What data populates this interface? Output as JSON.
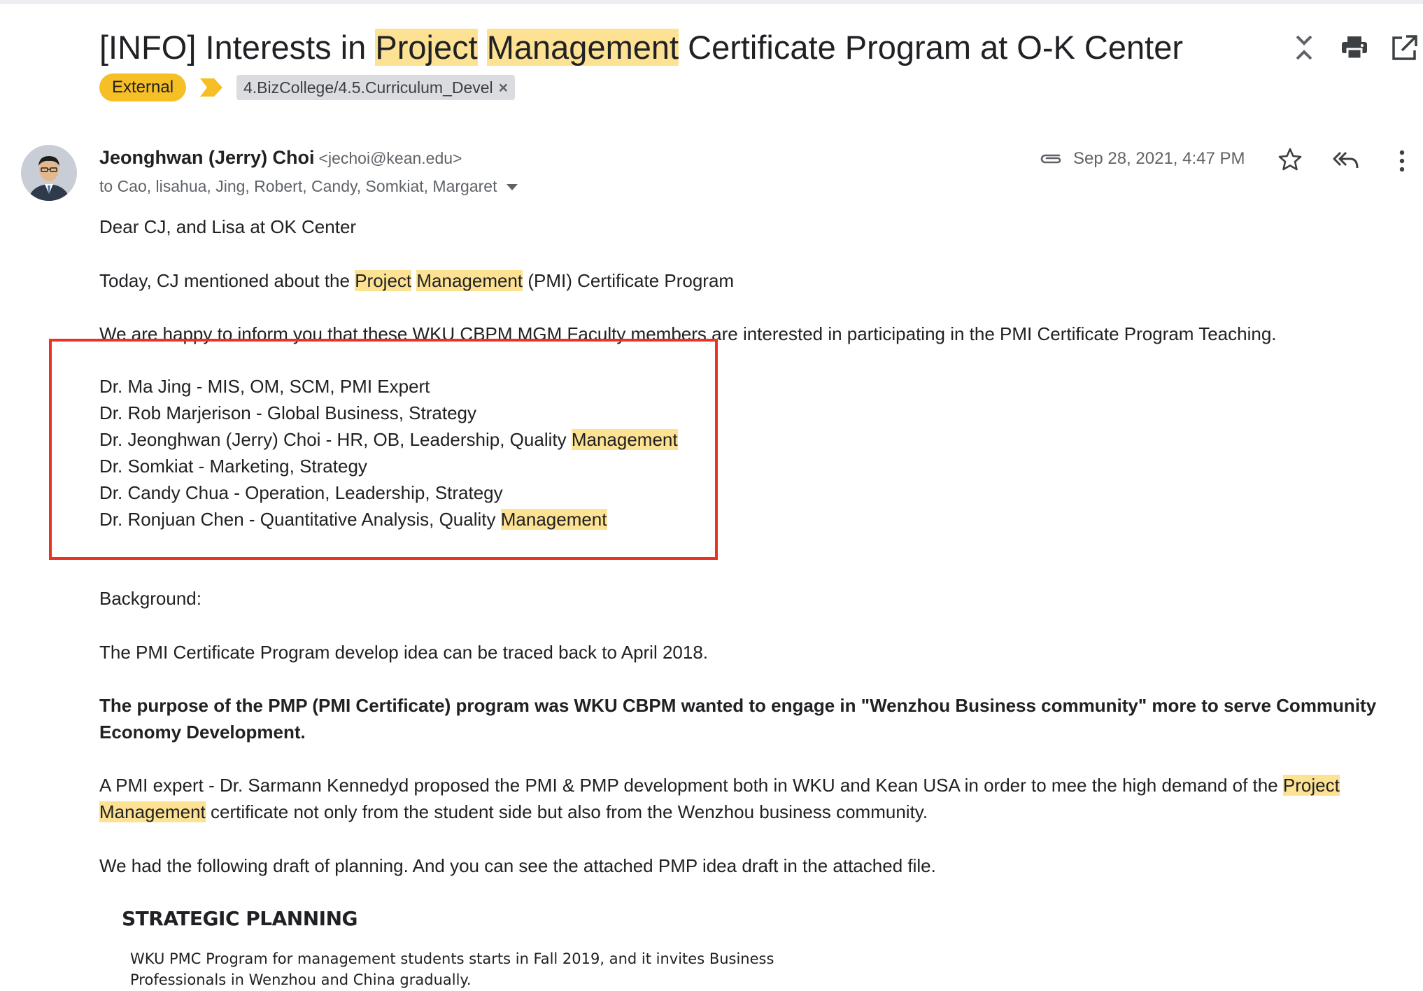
{
  "subject": {
    "prefix": "[INFO] Interests in ",
    "hl1": "Project",
    "space": " ",
    "hl2": "Management",
    "suffix": " Certificate Program at O-K Center"
  },
  "labels": {
    "external": "External",
    "folder": "4.BizCollege/4.5.Curriculum_Devel",
    "remove": "×"
  },
  "toolbar": {
    "collapse_icon": "collapse-expand-icon",
    "print_icon": "print-icon",
    "popout_icon": "open-in-new-window-icon"
  },
  "sender": {
    "name": "Jeonghwan (Jerry) Choi",
    "email": "<jechoi@kean.edu>",
    "recipients": "to Cao, lisahua, Jing, Robert, Candy, Somkiat, Margaret",
    "date": "Sep 28, 2021, 4:47 PM"
  },
  "body": {
    "greeting": "Dear CJ, and Lisa at OK Center",
    "line1_pre": "Today, CJ mentioned about the ",
    "line1_hl1": "Project",
    "line1_hl2": "Management",
    "line1_post": " (PMI) Certificate Program",
    "line2": "We are happy to inform you that these WKU CBPM MGM Faculty members are interested in participating in the PMI Certificate Program Teaching.",
    "faculty": [
      "Dr. Ma Jing - MIS, OM, SCM, PMI Expert",
      "Dr. Rob Marjerison - Global Business, Strategy",
      "Dr. Jeonghwan (Jerry) Choi - HR, OB, Leadership, Quality ",
      "Dr. Somkiat - Marketing, Strategy",
      "Dr. Candy Chua - Operation, Leadership, Strategy",
      "Dr. Ronjuan Chen - Quantitative Analysis, Quality "
    ],
    "faculty_hl": "Management",
    "background": "Background:",
    "traced": "The PMI Certificate Program develop idea can be traced back to April  2018.",
    "purpose": "The purpose of the PMP (PMI Certificate) program was WKU CBPM wanted to engage in \"Wenzhou Business community\" more to serve Community Economy Development.",
    "expert_pre": "A PMI expert - Dr. Sarmann Kennedyd proposed the PMI & PMP development both in WKU and Kean USA in order to mee the high demand of the ",
    "expert_hl1": "Project",
    "expert_hl2": "Management",
    "expert_post": " certificate not only from the student side but also from the Wenzhou business community.",
    "draft": "We had the following draft of planning. And you can see the attached PMP idea draft in the attached file.",
    "strategic_title": "STRATEGIC PLANNING",
    "strategic_text": "WKU PMC Program for management students starts in Fall 2019, and it invites Business Professionals in Wenzhou and China gradually."
  },
  "colors": {
    "highlight": "#fde293",
    "external_chip": "#f6bf26",
    "annotation_box": "#ea3323"
  }
}
